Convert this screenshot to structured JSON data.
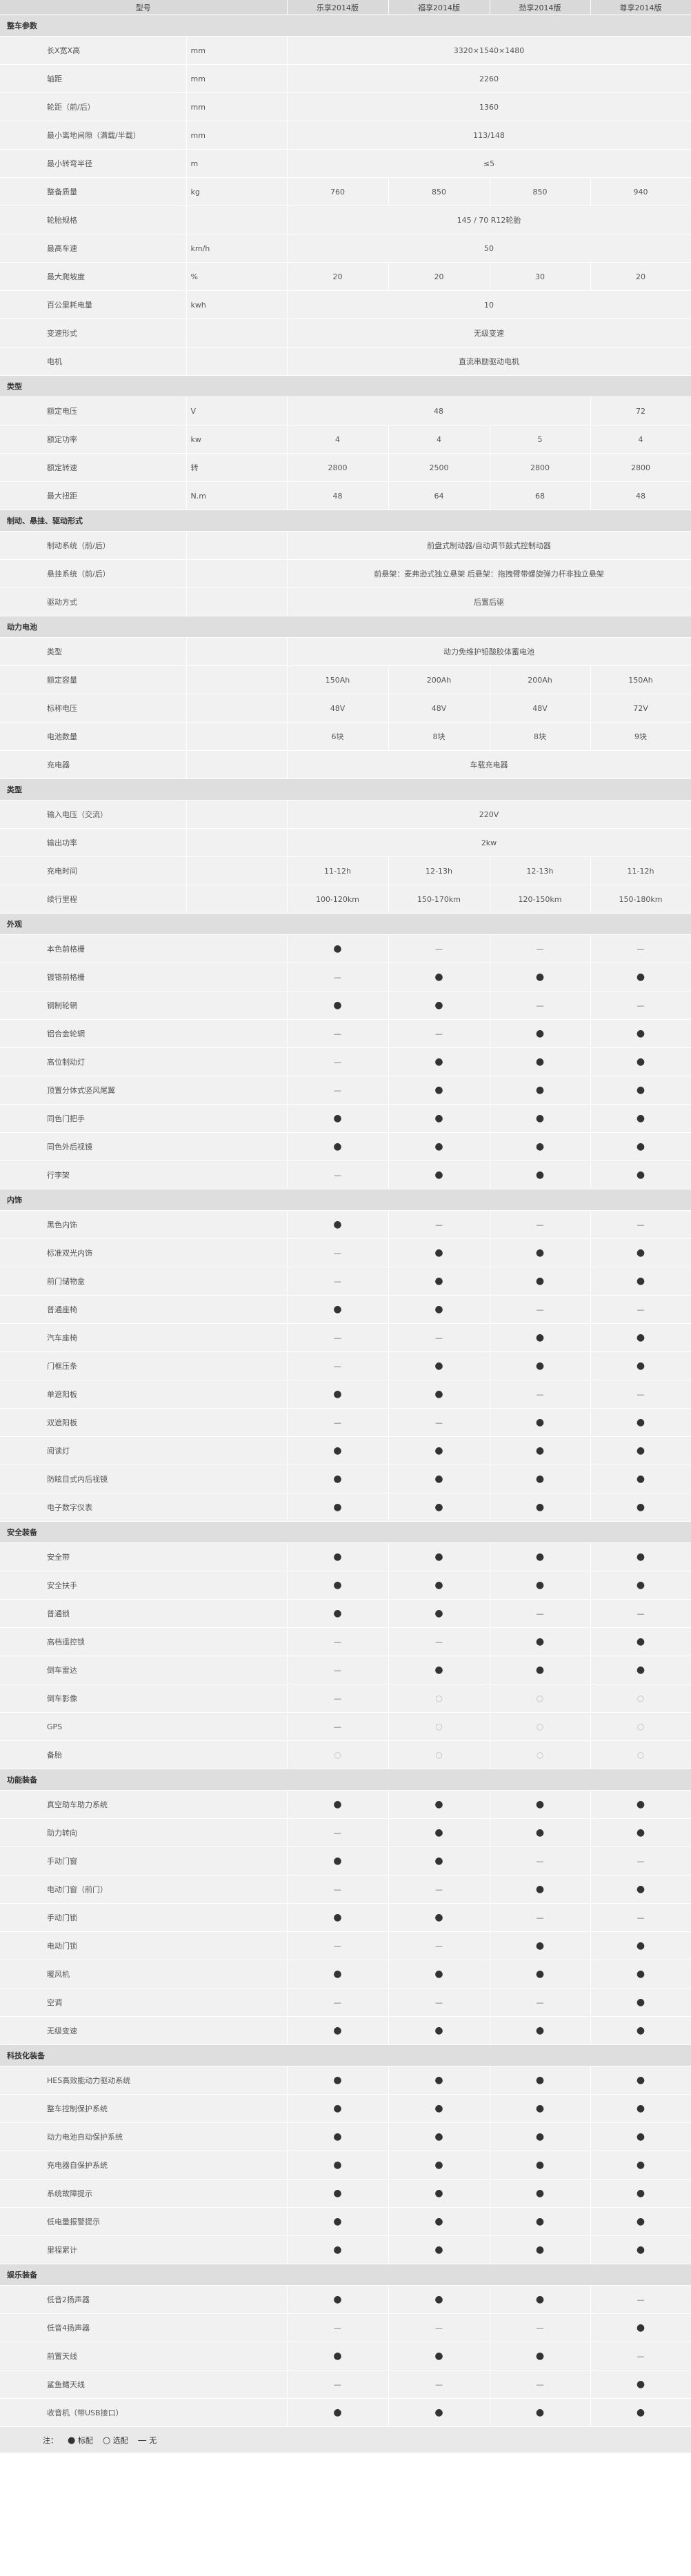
{
  "header": {
    "model_label": "型号",
    "versions": [
      "乐享2014版",
      "福享2014版",
      "劲享2014版",
      "尊享2014版"
    ]
  },
  "sections": [
    {
      "title": "整车参数",
      "rows": [
        {
          "name": "长X宽X高",
          "unit": "mm",
          "span": "3320×1540×1480"
        },
        {
          "name": "轴距",
          "unit": "mm",
          "span": "2260"
        },
        {
          "name": "轮距（前/后）",
          "unit": "mm",
          "span": "1360"
        },
        {
          "name": "最小离地间隙（满载/半载）",
          "unit": "mm",
          "span": "113/148"
        },
        {
          "name": "最小转弯半径",
          "unit": "m",
          "span": "≤5"
        },
        {
          "name": "整备质量",
          "unit": "kg",
          "values": [
            "760",
            "850",
            "850",
            "940"
          ]
        },
        {
          "name": "轮胎规格",
          "unit": "",
          "span": "145 / 70  R12轮胎"
        },
        {
          "name": "最高车速",
          "unit": "km/h",
          "span": "50"
        },
        {
          "name": "最大爬坡度",
          "unit": "%",
          "values": [
            "20",
            "20",
            "30",
            "20"
          ]
        },
        {
          "name": "百公里耗电量",
          "unit": "kwh",
          "span": "10"
        },
        {
          "name": "变速形式",
          "unit": "",
          "span": "无级变速"
        },
        {
          "name": "电机",
          "unit": "",
          "span": "直流串励驱动电机"
        }
      ]
    },
    {
      "title": "类型",
      "rows": [
        {
          "name": "额定电压",
          "unit": "V",
          "span3": "48",
          "last": "72"
        },
        {
          "name": "额定功率",
          "unit": "kw",
          "values": [
            "4",
            "4",
            "5",
            "4"
          ]
        },
        {
          "name": "额定转速",
          "unit": "转",
          "values": [
            "2800",
            "2500",
            "2800",
            "2800"
          ]
        },
        {
          "name": "最大扭距",
          "unit": "N.m",
          "values": [
            "48",
            "64",
            "68",
            "48"
          ]
        }
      ]
    },
    {
      "title": "制动、悬挂、驱动形式",
      "rows": [
        {
          "name": "制动系统（前/后）",
          "unit": "",
          "span": "前盘式制动器/自动调节鼓式控制动器"
        },
        {
          "name": "悬挂系统（前/后）",
          "unit": "",
          "span": "前悬架：麦弗逊式独立悬架      后悬架：拖拽臂带螺旋弹力杆非独立悬架"
        },
        {
          "name": "驱动方式",
          "unit": "",
          "span": "后置后驱"
        }
      ]
    },
    {
      "title": "动力电池",
      "rows": [
        {
          "name": "类型",
          "unit": "",
          "span": "动力免维护铅酸胶体蓄电池"
        },
        {
          "name": "额定容量",
          "unit": "",
          "values": [
            "150Ah",
            "200Ah",
            "200Ah",
            "150Ah"
          ]
        },
        {
          "name": "标称电压",
          "unit": "",
          "values": [
            "48V",
            "48V",
            "48V",
            "72V"
          ]
        },
        {
          "name": "电池数量",
          "unit": "",
          "values": [
            "6块",
            "8块",
            "8块",
            "9块"
          ]
        },
        {
          "name": "充电器",
          "unit": "",
          "span": "车载充电器"
        }
      ]
    },
    {
      "title": "类型",
      "rows": [
        {
          "name": "输入电压（交流）",
          "unit": "",
          "span": "220V"
        },
        {
          "name": "输出功率",
          "unit": "",
          "span": "2kw"
        },
        {
          "name": "充电时间",
          "unit": "",
          "values": [
            "11-12h",
            "12-13h",
            "12-13h",
            "11-12h"
          ]
        },
        {
          "name": "续行里程",
          "unit": "",
          "values": [
            "100-120km",
            "150-170km",
            "120-150km",
            "150-180km"
          ]
        }
      ]
    },
    {
      "title": "外观",
      "rows": [
        {
          "name": "本色前格栅",
          "marks": [
            "full",
            "none",
            "none",
            "none"
          ]
        },
        {
          "name": "镀铬前格栅",
          "marks": [
            "none",
            "full",
            "full",
            "full"
          ]
        },
        {
          "name": "钢制轮辋",
          "marks": [
            "full",
            "full",
            "none",
            "none"
          ]
        },
        {
          "name": "铝合金轮辋",
          "marks": [
            "none",
            "none",
            "full",
            "full"
          ]
        },
        {
          "name": "高位制动灯",
          "marks": [
            "none",
            "full",
            "full",
            "full"
          ]
        },
        {
          "name": "顶置分体式竖风尾翼",
          "marks": [
            "none",
            "full",
            "full",
            "full"
          ]
        },
        {
          "name": "同色门把手",
          "marks": [
            "full",
            "full",
            "full",
            "full"
          ]
        },
        {
          "name": "同色外后视镜",
          "marks": [
            "full",
            "full",
            "full",
            "full"
          ]
        },
        {
          "name": "行李架",
          "marks": [
            "none",
            "full",
            "full",
            "full"
          ]
        }
      ]
    },
    {
      "title": "内饰",
      "rows": [
        {
          "name": "黑色内饰",
          "marks": [
            "full",
            "none",
            "none",
            "none"
          ]
        },
        {
          "name": "标准双光内饰",
          "marks": [
            "none",
            "full",
            "full",
            "full"
          ]
        },
        {
          "name": "前门储物盒",
          "marks": [
            "none",
            "full",
            "full",
            "full"
          ]
        },
        {
          "name": "普通座椅",
          "marks": [
            "full",
            "full",
            "none",
            "none"
          ]
        },
        {
          "name": "汽车座椅",
          "marks": [
            "none",
            "none",
            "full",
            "full"
          ]
        },
        {
          "name": "门框压条",
          "marks": [
            "none",
            "full",
            "full",
            "full"
          ]
        },
        {
          "name": "单遮阳板",
          "marks": [
            "full",
            "full",
            "none",
            "none"
          ]
        },
        {
          "name": "双遮阳板",
          "marks": [
            "none",
            "none",
            "full",
            "full"
          ]
        },
        {
          "name": "阅读灯",
          "marks": [
            "full",
            "full",
            "full",
            "full"
          ]
        },
        {
          "name": "防眩目式内后视镜",
          "marks": [
            "full",
            "full",
            "full",
            "full"
          ]
        },
        {
          "name": "电子数字仪表",
          "marks": [
            "full",
            "full",
            "full",
            "full"
          ]
        }
      ]
    },
    {
      "title": "安全装备",
      "rows": [
        {
          "name": "安全带",
          "marks": [
            "full",
            "full",
            "full",
            "full"
          ]
        },
        {
          "name": "安全扶手",
          "marks": [
            "full",
            "full",
            "full",
            "full"
          ]
        },
        {
          "name": "普通锁",
          "marks": [
            "full",
            "full",
            "none",
            "none"
          ]
        },
        {
          "name": "高档遥控锁",
          "marks": [
            "none",
            "none",
            "full",
            "full"
          ]
        },
        {
          "name": "倒车雷达",
          "marks": [
            "none",
            "full",
            "full",
            "full"
          ]
        },
        {
          "name": "倒车影像",
          "marks": [
            "none",
            "opt",
            "opt",
            "opt"
          ]
        },
        {
          "name": "GPS",
          "marks": [
            "none",
            "opt",
            "opt",
            "opt"
          ]
        },
        {
          "name": "备胎",
          "marks": [
            "opt",
            "opt",
            "opt",
            "opt"
          ]
        }
      ]
    },
    {
      "title": "功能装备",
      "rows": [
        {
          "name": "真空助车助力系统",
          "marks": [
            "full",
            "full",
            "full",
            "full"
          ]
        },
        {
          "name": "助力转向",
          "marks": [
            "none",
            "full",
            "full",
            "full"
          ]
        },
        {
          "name": "手动门窗",
          "marks": [
            "full",
            "full",
            "none",
            "none"
          ]
        },
        {
          "name": "电动门窗（前门）",
          "marks": [
            "none",
            "none",
            "full",
            "full"
          ]
        },
        {
          "name": "手动门锁",
          "marks": [
            "full",
            "full",
            "none",
            "none"
          ]
        },
        {
          "name": "电动门锁",
          "marks": [
            "none",
            "none",
            "full",
            "full"
          ]
        },
        {
          "name": "暖风机",
          "marks": [
            "full",
            "full",
            "full",
            "full"
          ]
        },
        {
          "name": "空调",
          "marks": [
            "none",
            "none",
            "none",
            "full"
          ]
        },
        {
          "name": "无级变速",
          "marks": [
            "full",
            "full",
            "full",
            "full"
          ]
        }
      ]
    },
    {
      "title": "科技化装备",
      "rows": [
        {
          "name": "HES高效能动力驱动系统",
          "marks": [
            "full",
            "full",
            "full",
            "full"
          ]
        },
        {
          "name": "整车控制保护系统",
          "marks": [
            "full",
            "full",
            "full",
            "full"
          ]
        },
        {
          "name": "动力电池自动保护系统",
          "marks": [
            "full",
            "full",
            "full",
            "full"
          ]
        },
        {
          "name": "充电器自保护系统",
          "marks": [
            "full",
            "full",
            "full",
            "full"
          ]
        },
        {
          "name": "系统故障提示",
          "marks": [
            "full",
            "full",
            "full",
            "full"
          ]
        },
        {
          "name": "低电量报警提示",
          "marks": [
            "full",
            "full",
            "full",
            "full"
          ]
        },
        {
          "name": "里程累计",
          "marks": [
            "full",
            "full",
            "full",
            "full"
          ]
        }
      ]
    },
    {
      "title": "娱乐装备",
      "rows": [
        {
          "name": "低音2扬声器",
          "marks": [
            "full",
            "full",
            "full",
            "none"
          ]
        },
        {
          "name": "低音4扬声器",
          "marks": [
            "none",
            "none",
            "none",
            "full"
          ]
        },
        {
          "name": "前置天线",
          "marks": [
            "full",
            "full",
            "full",
            "none"
          ]
        },
        {
          "name": "鲨鱼鳍天线",
          "marks": [
            "none",
            "none",
            "none",
            "full"
          ]
        },
        {
          "name": "收音机（带USB接口）",
          "marks": [
            "full",
            "full",
            "full",
            "full"
          ]
        }
      ]
    }
  ],
  "symbols": {
    "full": "●",
    "opt": "○",
    "none": "—"
  },
  "legend": {
    "prefix": "注：",
    "full_symbol": "●",
    "full_label": "标配",
    "opt_symbol": "○",
    "opt_label": "选配",
    "none_symbol": "—",
    "none_label": "无"
  }
}
